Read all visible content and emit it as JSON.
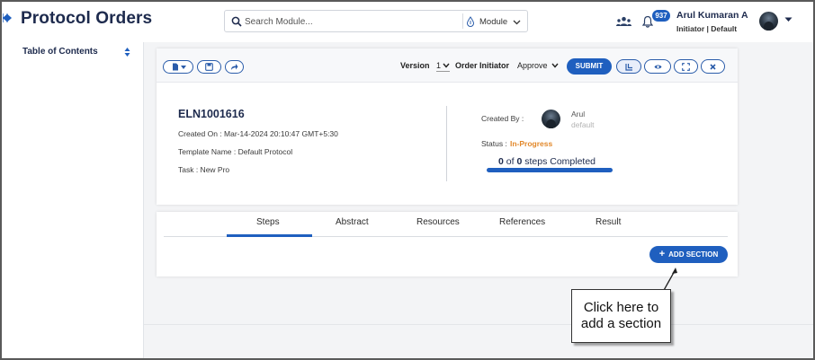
{
  "header": {
    "title": "Protocol Orders",
    "search_placeholder": "Search Module...",
    "module_label": "Module",
    "notification_count": "937",
    "user_name": "Arul Kumaran A",
    "user_role": "Initiator | Default"
  },
  "sidebar": {
    "title": "Table of Contents"
  },
  "toolbar": {
    "version_label": "Version",
    "version_value": "1",
    "order_initiator_label": "Order Initiator",
    "order_initiator_value": "Approve",
    "submit_label": "SUBMIT"
  },
  "order": {
    "id": "ELN1001616",
    "created_on": "Created On : Mar-14-2024 20:10:47 GMT+5:30",
    "template_name": "Template Name : Default Protocol",
    "task": "Task : New Pro",
    "created_by_label": "Created By :",
    "creator_name": "Arul",
    "creator_role": "default",
    "status_label": "Status :",
    "status_value": "In-Progress",
    "steps_done": "0",
    "steps_of": "of",
    "steps_total": "0",
    "steps_suffix": "steps Completed",
    "progress_fraction": 1.0
  },
  "tabs": {
    "items": [
      {
        "label": "Steps",
        "active": true
      },
      {
        "label": "Abstract",
        "active": false
      },
      {
        "label": "Resources",
        "active": false
      },
      {
        "label": "References",
        "active": false
      },
      {
        "label": "Result",
        "active": false
      }
    ],
    "add_section_label": "ADD SECTION"
  },
  "callout": {
    "line1": "Click here to",
    "line2": "add a section"
  },
  "colors": {
    "accent": "#1f5fbf",
    "status": "#e2882a",
    "title": "#1d2a4d"
  }
}
